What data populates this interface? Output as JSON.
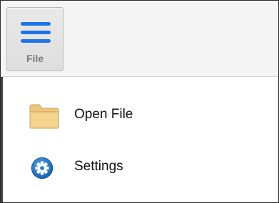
{
  "toolbar": {
    "file_button": {
      "label": "File",
      "icon": "hamburger-menu-icon"
    }
  },
  "menu": {
    "items": [
      {
        "label": "Open File",
        "icon": "folder-icon"
      },
      {
        "label": "Settings",
        "icon": "gear-icon"
      }
    ]
  },
  "colors": {
    "hamburger": "#1a73e8",
    "folder_fill": "#f5d48e",
    "folder_stroke": "#c9a25a",
    "gear_badge": "#1778d0",
    "text": "#111111"
  }
}
